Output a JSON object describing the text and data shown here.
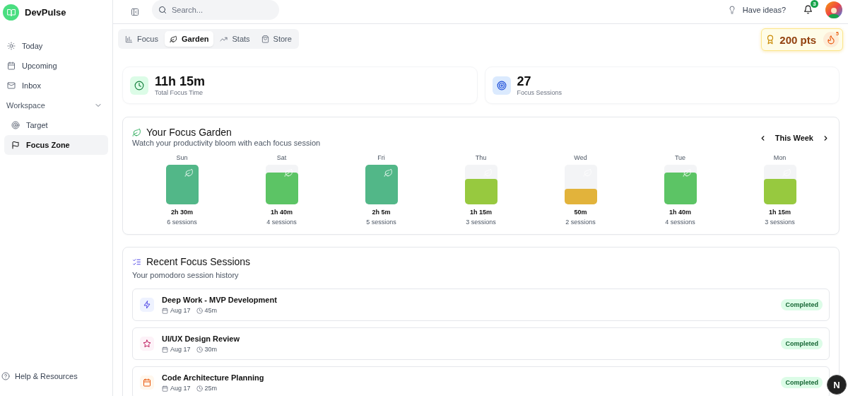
{
  "app": {
    "name": "DevPulse"
  },
  "sidebar": {
    "items": [
      {
        "label": "Today",
        "kind": "sun",
        "selected": false
      },
      {
        "label": "Upcoming",
        "kind": "calendar",
        "selected": false
      },
      {
        "label": "Inbox",
        "kind": "mail",
        "selected": false
      }
    ],
    "section": {
      "label": "Workspace",
      "expanded": true,
      "items": [
        {
          "label": "Target",
          "kind": "target",
          "selected": false
        },
        {
          "label": "Focus Zone",
          "kind": "flag",
          "selected": true
        }
      ]
    },
    "footer": {
      "label": "Help & Resources"
    }
  },
  "header": {
    "search": {
      "placeholder": "Search..."
    },
    "ideas_label": "Have ideas?",
    "notification_count": "3"
  },
  "tabs": [
    {
      "label": "Focus",
      "kind": "chart",
      "selected": false
    },
    {
      "label": "Garden",
      "kind": "leaf",
      "selected": true
    },
    {
      "label": "Stats",
      "kind": "trend",
      "selected": false
    },
    {
      "label": "Store",
      "kind": "bag",
      "selected": false
    }
  ],
  "points": {
    "label": "200 pts",
    "streak": "5"
  },
  "stats": [
    {
      "value": "11h 15m",
      "label": "Total Focus Time",
      "kind": "clock"
    },
    {
      "value": "27",
      "label": "Focus Sessions",
      "kind": "target"
    }
  ],
  "garden": {
    "title": "Your Focus Garden",
    "subtitle": "Watch your productivity bloom with each focus session",
    "period": "This Week",
    "days": [
      {
        "day": "Sun",
        "duration": "2h 30m",
        "sessions": "6 sessions",
        "level": 1,
        "color": "#52b788"
      },
      {
        "day": "Sat",
        "duration": "1h 40m",
        "sessions": "4 sessions",
        "level": 0.8,
        "color": "#5cc465"
      },
      {
        "day": "Fri",
        "duration": "2h 5m",
        "sessions": "5 sessions",
        "level": 1,
        "color": "#52b788"
      },
      {
        "day": "Thu",
        "duration": "1h 15m",
        "sessions": "3 sessions",
        "level": 0.65,
        "color": "#97c93f"
      },
      {
        "day": "Wed",
        "duration": "50m",
        "sessions": "2 sessions",
        "level": 0.4,
        "color": "#e2b33b"
      },
      {
        "day": "Tue",
        "duration": "1h 40m",
        "sessions": "4 sessions",
        "level": 0.8,
        "color": "#5cc465"
      },
      {
        "day": "Mon",
        "duration": "1h 15m",
        "sessions": "3 sessions",
        "level": 0.65,
        "color": "#97c93f"
      }
    ]
  },
  "recent": {
    "title": "Recent Focus Sessions",
    "subtitle": "Your pomodoro session history",
    "sessions": [
      {
        "title": "Deep Work - MVP Development",
        "kind": "bolt",
        "date": "Aug 17",
        "duration": "45m",
        "status": "Completed"
      },
      {
        "title": "UI/UX Design Review",
        "kind": "star",
        "date": "Aug 17",
        "duration": "30m",
        "status": "Completed"
      },
      {
        "title": "Code Architecture Planning",
        "kind": "calendar",
        "date": "Aug 17",
        "duration": "25m",
        "status": "Completed"
      }
    ]
  },
  "dev_badge": {
    "label": "N"
  }
}
